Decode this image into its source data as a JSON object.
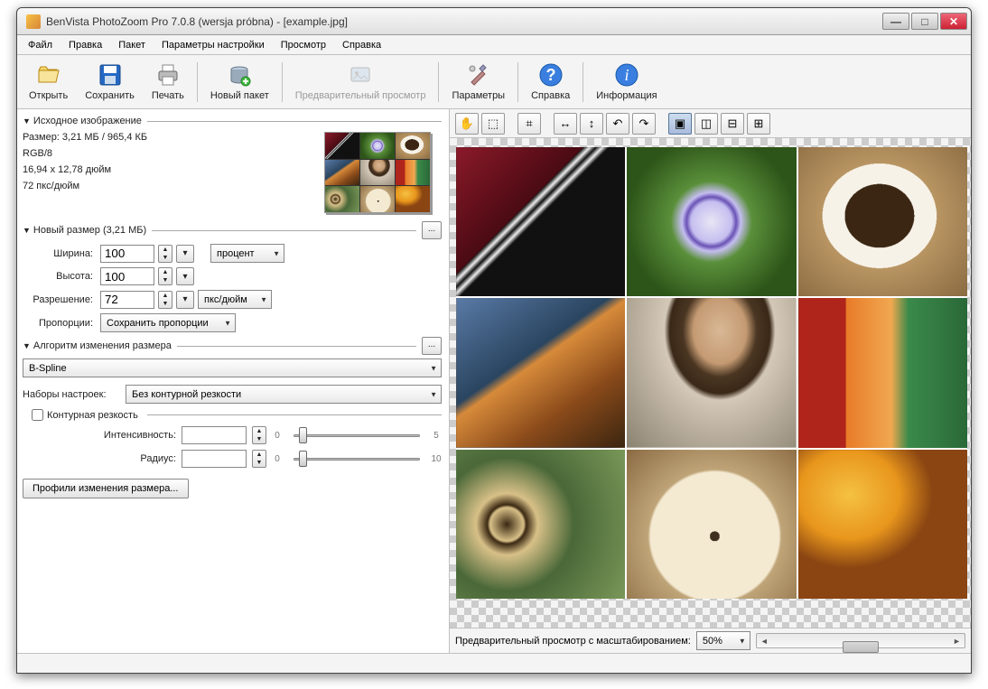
{
  "title": "BenVista PhotoZoom Pro 7.0.8 (wersja próbna) - [example.jpg]",
  "menu": [
    "Файл",
    "Правка",
    "Пакет",
    "Параметры настройки",
    "Просмотр",
    "Справка"
  ],
  "toolbar": {
    "open": "Открыть",
    "save": "Сохранить",
    "print": "Печать",
    "newbatch": "Новый пакет",
    "preview": "Предварительный просмотр",
    "options": "Параметры",
    "help": "Справка",
    "info": "Информация"
  },
  "source": {
    "header": "Исходное изображение",
    "size": "Размер: 3,21 МБ / 965,4 КБ",
    "mode": "RGB/8",
    "dim": "16,94 x 12,78 дюйм",
    "res": "72 пкс/дюйм"
  },
  "newsize": {
    "header": "Новый размер (3,21 МБ)",
    "width_label": "Ширина:",
    "width": "100",
    "height_label": "Высота:",
    "height": "100",
    "unit": "процент",
    "res_label": "Разрешение:",
    "res": "72",
    "res_unit": "пкс/дюйм",
    "aspect_label": "Пропорции:",
    "aspect": "Сохранить пропорции"
  },
  "resize": {
    "header": "Алгоритм изменения размера",
    "method": "B-Spline",
    "presets_label": "Наборы настроек:",
    "preset": "Без контурной резкости",
    "unsharp_label": "Контурная резкость",
    "intensity_label": "Интенсивность:",
    "intensity": "",
    "intensity_min": "0",
    "intensity_max": "5",
    "radius_label": "Радиус:",
    "radius": "",
    "radius_min": "0",
    "radius_max": "10",
    "profiles_btn": "Профили изменения размера..."
  },
  "preview": {
    "zoom_label": "Предварительный просмотр с масштабированием:",
    "zoom": "50%"
  }
}
